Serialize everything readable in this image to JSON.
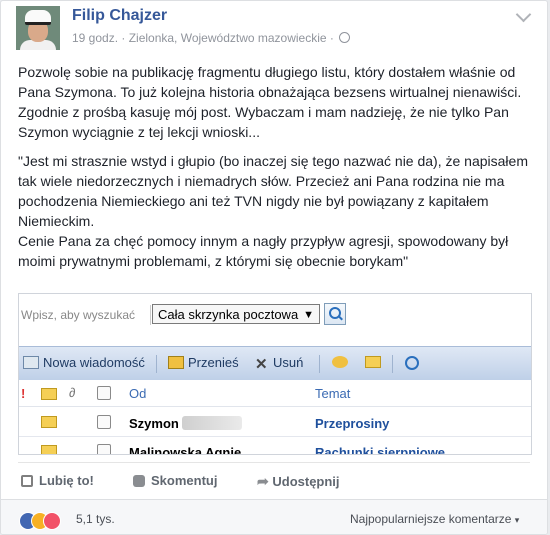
{
  "post": {
    "author": "Filip Chajzer",
    "meta": "19 godz. · Zielonka, Województwo mazowieckie · ",
    "paragraph1": "Pozwolę sobie na publikację fragmentu długiego listu, który dostałem właśnie od Pana Szymona. To już kolejna historia obnażająca bezsens wirtualnej nienawiści. Zgodnie z prośbą kasuję mój post. Wybaczam i mam nadzieję, że nie tylko Pan Szymon wyciągnie z tej lekcji wnioski...",
    "paragraph2a": "\"Jest mi strasznie wstyd i głupio (bo inaczej się tego nazwać nie da), że napisałem tak wiele niedorzecznych i niemadrych słów. Przecież ani Pana rodzina nie ma pochodzenia Niemieckiego ani też TVN nigdy nie był powiązany z kapitałem Niemieckim.",
    "paragraph2b": "Cenie Pana za chęć pomocy innym a nagły przypływ agresji, spowodowany był moimi prywatnymi problemami, z którymi się obecnie borykam\""
  },
  "mail": {
    "search_placeholder": "Wpisz, aby wyszukać",
    "scope_selected": "Cała skrzynka pocztowa",
    "toolbar": {
      "new_label": "Nowa wiadomość",
      "move_label": "Przenieś",
      "delete_label": "Usuń"
    },
    "columns": {
      "from": "Od",
      "subject": "Temat"
    },
    "rows": [
      {
        "from": "Szymon",
        "subject": "Przeprosiny"
      },
      {
        "from": "Malinowska Agnie",
        "subject": "Rachunki sierpniowe"
      }
    ]
  },
  "actions": {
    "like": "Lubię to!",
    "comment": "Skomentuj",
    "share": "Udostępnij"
  },
  "footer": {
    "reactions_count": "5,1 tys.",
    "sort_label": "Najpopularniejsze komentarze"
  },
  "colors": {
    "link_blue": "#365899",
    "like_blue": "#4267b2",
    "haha_yellow": "#f7b125",
    "love_red": "#f25268"
  },
  "icons": [
    "globe-icon",
    "chevron-down-icon",
    "search-icon",
    "envelope-icon",
    "attachment-icon",
    "thumb-up-icon",
    "comment-icon",
    "share-icon"
  ]
}
